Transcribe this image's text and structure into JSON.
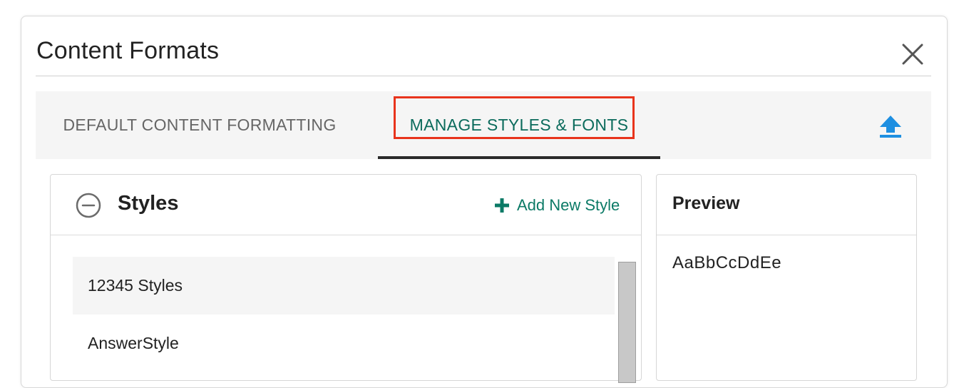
{
  "dialog": {
    "title": "Content Formats"
  },
  "tabs": [
    {
      "label": "DEFAULT CONTENT FORMATTING",
      "active": false
    },
    {
      "label": "MANAGE STYLES & FONTS",
      "active": true
    }
  ],
  "styles_panel": {
    "heading": "Styles",
    "add_label": "Add New Style",
    "items": [
      {
        "label": "12345 Styles",
        "selected": true
      },
      {
        "label": "AnswerStyle",
        "selected": false
      }
    ]
  },
  "preview_panel": {
    "heading": "Preview",
    "sample_text": "AaBbCcDdEe"
  },
  "icons": {
    "close": "close-icon",
    "upload": "upload-icon",
    "collapse": "minus-circle-icon",
    "add": "plus-icon"
  },
  "colors": {
    "accent": "#0b7a66",
    "active_tab_text": "#0b6b5c",
    "upload_icon": "#1e8fe1",
    "highlight_box": "#e8341c"
  }
}
